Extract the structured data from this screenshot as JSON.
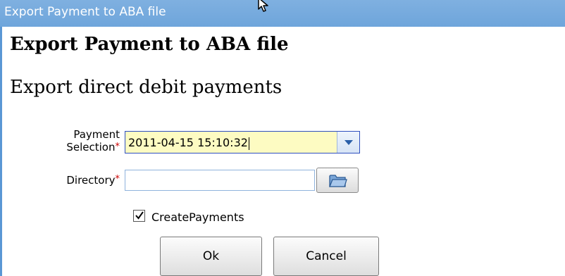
{
  "window": {
    "title": "Export Payment to ABA file"
  },
  "dialog": {
    "heading": "Export Payment to ABA file",
    "subheading": "Export direct debit payments"
  },
  "form": {
    "payment_selection": {
      "label_line1": "Payment",
      "label_line2": "Selection",
      "required_mark": "*",
      "value": "2011-04-15 15:10:32"
    },
    "directory": {
      "label": "Directory",
      "required_mark": "*",
      "value": ""
    },
    "create_payments": {
      "label": "CreatePayments",
      "checked": true
    }
  },
  "buttons": {
    "ok_label": "Ok",
    "cancel_label": "Cancel"
  },
  "icons": {
    "dropdown": "chevron-down-icon",
    "browse": "folder-icon",
    "check": "check-icon",
    "cursor": "mouse-pointer-icon"
  },
  "colors": {
    "titlebar": "#6ea5db",
    "frame_border": "#5a97d5",
    "active_field_bg": "#fdfbc2",
    "active_field_border": "#2f4fbf",
    "required_mark": "#cc0000"
  }
}
